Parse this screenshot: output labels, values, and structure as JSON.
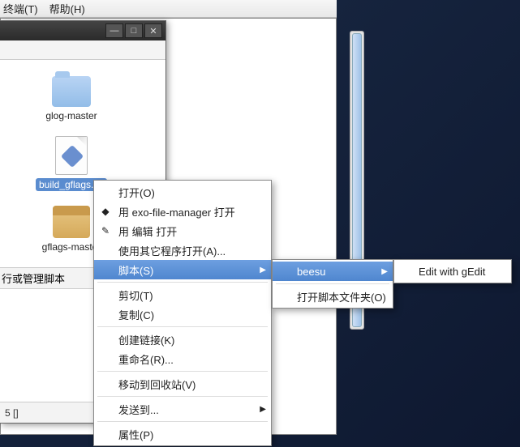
{
  "menubar": {
    "terminal": "终端(T)",
    "help": "帮助(H)"
  },
  "files": {
    "item1": "glog-master",
    "item2": "build_gflags.sh",
    "item3": "gflags-master"
  },
  "status": {
    "left": "5 []",
    "crop_label": "行或管理脚本"
  },
  "ctx": {
    "open": "打开(O)",
    "open_with_exo": "用 exo-file-manager 打开",
    "open_with_editor": "用 编辑 打开",
    "open_with_other": "使用其它程序打开(A)...",
    "script": "脚本(S)",
    "cut": "剪切(T)",
    "copy": "复制(C)",
    "create_link": "创建链接(K)",
    "rename": "重命名(R)...",
    "trash": "移动到回收站(V)",
    "send_to": "发送到...",
    "properties": "属性(P)"
  },
  "sub1": {
    "beesu": "beesu",
    "open_script_folder": "打开脚本文件夹(O)"
  },
  "sub2": {
    "edit_gedit": "Edit with gEdit"
  },
  "icons": {
    "app_icon": "◆",
    "edit_icon": "✎"
  }
}
